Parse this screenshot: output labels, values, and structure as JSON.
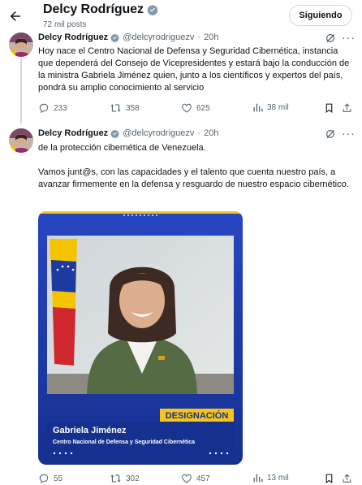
{
  "header": {
    "back_icon": "arrow-left-icon",
    "title": "Delcy Rodríguez",
    "subtitle": "72 mil posts",
    "follow_label": "Siguiendo"
  },
  "tweets": [
    {
      "name": "Delcy Rodríguez",
      "handle": "@delcyrodriguezv",
      "dot": "·",
      "time": "20h",
      "text": "Hoy nace el Centro Nacional de Defensa y Seguridad Cibernética, instancia que dependerá del Consejo de Vicepresidentes y estará bajo la conducción de la ministra Gabriela Jiménez quien, junto a los científicos y expertos del país, pondrá su amplio conocimiento al servicio",
      "replies": "233",
      "reposts": "358",
      "likes": "625",
      "views": "38 mil"
    },
    {
      "name": "Delcy Rodríguez",
      "handle": "@delcyrodriguezv",
      "dot": "·",
      "time": "20h",
      "text": "de la protección cibernética de Venezuela.\n\nVamos junt@s, con las capacidades y el talento que cuenta nuestro país, a avanzar firmemente en la defensa y resguardo de nuestro espacio cibernético.",
      "image": {
        "banner": "DESIGNACIÓN",
        "person_name": "Gabriela Jiménez",
        "person_title": "Centro Nacional de Defensa y Seguridad Cibernética"
      },
      "replies": "55",
      "reposts": "302",
      "likes": "457",
      "views": "13 mil"
    }
  ],
  "colors": {
    "text": "#0f1419",
    "muted": "#536471",
    "verified": "#829aab",
    "media_blue": "#1f3fae",
    "banner_yellow": "#f7c518"
  }
}
